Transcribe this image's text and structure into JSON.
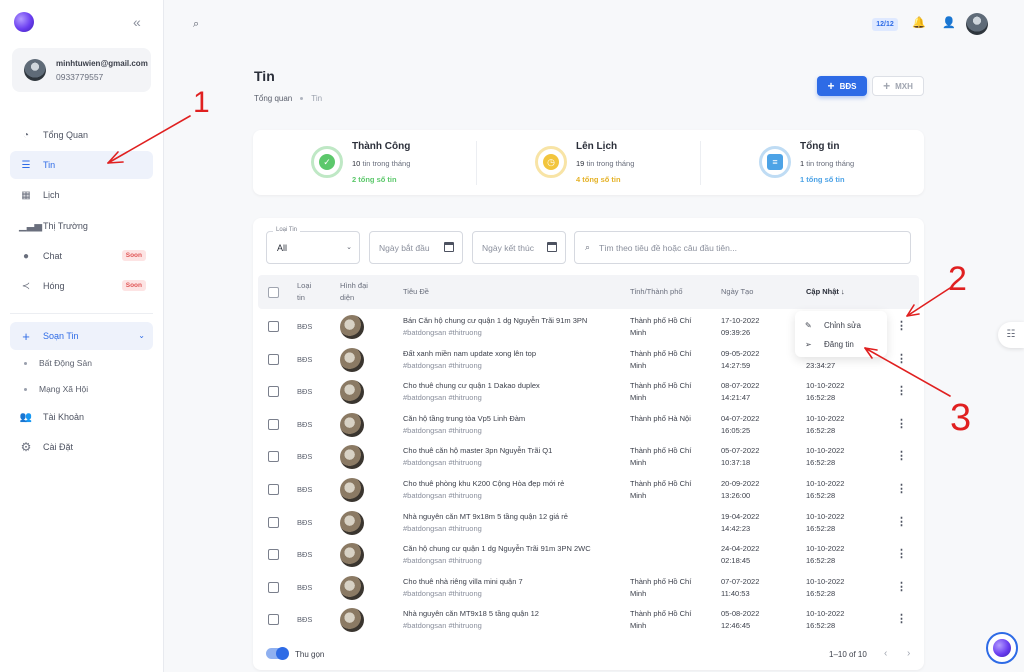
{
  "sidebar": {
    "collapse_icon": "«",
    "user": {
      "email": "minhtuwien@gmail.com",
      "phone": "0933779557"
    },
    "items": [
      {
        "label": "Tổng Quan",
        "icon": "dashboard-icon"
      },
      {
        "label": "Tin",
        "icon": "list-icon",
        "active": true
      },
      {
        "label": "Lịch",
        "icon": "calendar-icon"
      },
      {
        "label": "Thị Trường",
        "icon": "market-chart-icon"
      },
      {
        "label": "Chat",
        "icon": "chat-icon",
        "badge": "Soon"
      },
      {
        "label": "Hóng",
        "icon": "share-icon",
        "badge": "Soon"
      }
    ],
    "compose": {
      "label": "Soạn Tin",
      "sub_items": [
        "Bất Động Sản",
        "Mạng Xã Hội"
      ]
    },
    "bottom_items": [
      {
        "label": "Tài Khoản",
        "icon": "users-icon"
      },
      {
        "label": "Cài Đặt",
        "icon": "gear-icon"
      }
    ]
  },
  "topbar": {
    "count_badge": "12/12"
  },
  "page": {
    "title": "Tin",
    "breadcrumb": [
      "Tổng quan",
      "Tin"
    ],
    "btn_bds": "BĐS",
    "btn_mxh": "MXH"
  },
  "stats": [
    {
      "title": "Thành Công",
      "count": "10",
      "sub": "tin trong tháng",
      "total": "2 tổng số tin",
      "color": "#5cc86b"
    },
    {
      "title": "Lên Lịch",
      "count": "19",
      "sub": "tin trong tháng",
      "total": "4 tổng số tin",
      "color": "#f2c53d"
    },
    {
      "title": "Tổng tin",
      "count": "1",
      "sub": "tin trong tháng",
      "total": "1 tổng số tin",
      "color": "#4da3e6"
    }
  ],
  "filters": {
    "type_legend": "Loại Tin",
    "type_value": "All",
    "start_placeholder": "Ngày bắt đầu",
    "end_placeholder": "Ngày kết thúc",
    "search_placeholder": "Tìm theo tiêu đề hoặc câu đầu tiên..."
  },
  "table": {
    "columns": {
      "type": [
        "Loại",
        "tin"
      ],
      "image": [
        "Hình đại",
        "diện"
      ],
      "title": "Tiêu Đề",
      "city": "Tỉnh/Thành phố",
      "created": "Ngày Tạo",
      "updated": "Cập Nhật ↓"
    },
    "rows": [
      {
        "type": "BĐS",
        "title": "Bán Căn hộ chung cư quận 1 dg Nguyễn Trãi 91m 3PN",
        "tags": "#batdongsan #thitruong",
        "city": [
          "Thành phố Hồ Chí",
          "Minh"
        ],
        "created": [
          "17-10-2022",
          "09:39:26"
        ],
        "updated": [
          "",
          ""
        ]
      },
      {
        "type": "BĐS",
        "title": "Đất xanh miền nam update xong lên top",
        "tags": "#batdongsan #thitruong",
        "city": [
          "Thành phố Hồ Chí",
          "Minh"
        ],
        "created": [
          "09-05-2022",
          "14:27:59"
        ],
        "updated": [
          "",
          "23:34:27"
        ]
      },
      {
        "type": "BĐS",
        "title": "Cho thuê chung cư quận 1 Dakao duplex",
        "tags": "#batdongsan #thitruong",
        "city": [
          "Thành phố Hồ Chí",
          "Minh"
        ],
        "created": [
          "08-07-2022",
          "14:21:47"
        ],
        "updated": [
          "10-10-2022",
          "16:52:28"
        ]
      },
      {
        "type": "BĐS",
        "title": "Căn hộ tầng trung tòa Vp5 Linh Đàm",
        "tags": "#batdongsan #thitruong",
        "city": [
          "Thành phố Hà Nội",
          ""
        ],
        "created": [
          "04-07-2022",
          "16:05:25"
        ],
        "updated": [
          "10-10-2022",
          "16:52:28"
        ]
      },
      {
        "type": "BĐS",
        "title": "Cho thuê căn hộ master 3pn Nguyễn Trãi Q1",
        "tags": "#batdongsan #thitruong",
        "city": [
          "Thành phố Hồ Chí",
          "Minh"
        ],
        "created": [
          "05-07-2022",
          "10:37:18"
        ],
        "updated": [
          "10-10-2022",
          "16:52:28"
        ]
      },
      {
        "type": "BĐS",
        "title": "Cho thuê phòng khu K200 Cộng Hòa đẹp mới rẻ",
        "tags": "#batdongsan #thitruong",
        "city": [
          "Thành phố Hồ Chí",
          "Minh"
        ],
        "created": [
          "20-09-2022",
          "13:26:00"
        ],
        "updated": [
          "10-10-2022",
          "16:52:28"
        ]
      },
      {
        "type": "BĐS",
        "title": "Nhà nguyên căn MT 9x18m 5 tầng quận 12 giá rẻ",
        "tags": "#batdongsan #thitruong",
        "city": [
          "",
          ""
        ],
        "created": [
          "19-04-2022",
          "14:42:23"
        ],
        "updated": [
          "10-10-2022",
          "16:52:28"
        ]
      },
      {
        "type": "BĐS",
        "title": "Căn hộ chung cư quận 1 dg Nguyễn Trãi 91m 3PN 2WC",
        "tags": "#batdongsan #thitruong",
        "city": [
          "",
          ""
        ],
        "created": [
          "24-04-2022",
          "02:18:45"
        ],
        "updated": [
          "10-10-2022",
          "16:52:28"
        ]
      },
      {
        "type": "BĐS",
        "title": "Cho thuê nhà riêng villa mini quận 7",
        "tags": "#batdongsan #thitruong",
        "city": [
          "Thành phố Hồ Chí",
          "Minh"
        ],
        "created": [
          "07-07-2022",
          "11:40:53"
        ],
        "updated": [
          "10-10-2022",
          "16:52:28"
        ]
      },
      {
        "type": "BĐS",
        "title": "Nhà nguyên căn MT9x18 5 tầng quận 12",
        "tags": "#batdongsan #thitruong",
        "city": [
          "Thành phố Hồ Chí",
          "Minh"
        ],
        "created": [
          "05-08-2022",
          "12:46:45"
        ],
        "updated": [
          "10-10-2022",
          "16:52:28"
        ]
      }
    ]
  },
  "footer": {
    "toggle_label": "Thu gọn",
    "pagination": "1–10 of 10"
  },
  "context_menu": {
    "items": [
      {
        "label": "Chỉnh sửa",
        "icon": "pencil-icon"
      },
      {
        "label": "Đăng tin",
        "icon": "send-icon"
      }
    ]
  },
  "annotations": [
    "1",
    "2",
    "3"
  ],
  "accent_color": "#2e6be6"
}
